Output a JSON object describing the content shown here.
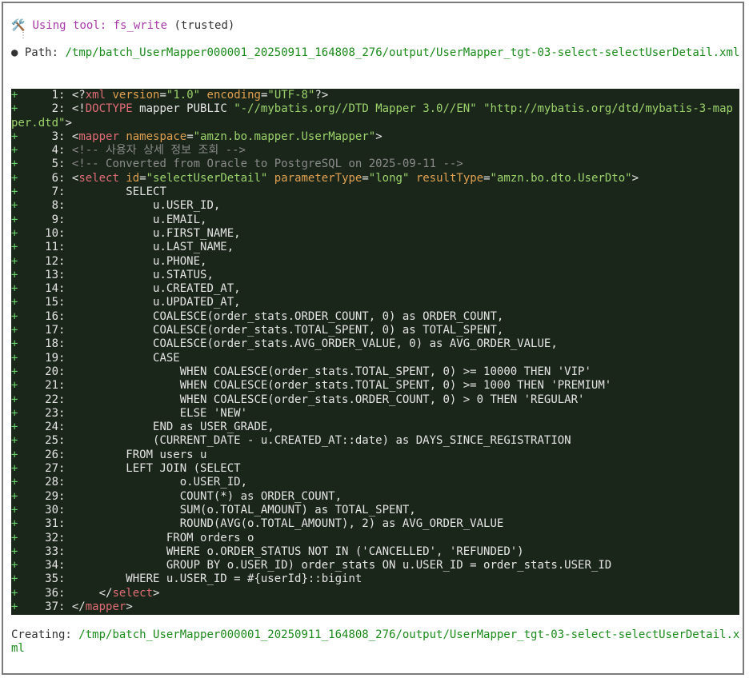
{
  "header": {
    "tool_icon": "🛠️",
    "label": "Using tool:",
    "tool_name": "fs_write",
    "trust": "(trusted)"
  },
  "path": {
    "bullet": "●",
    "label": "Path:",
    "value": "/tmp/batch_UserMapper000001_20250911_164808_276/output/UserMapper_tgt-03-select-selectUserDetail.xml"
  },
  "code_lines": [
    {
      "n": "1",
      "text": "<?xml version=\"1.0\" encoding=\"UTF-8\"?>"
    },
    {
      "n": "2",
      "text": "<!DOCTYPE mapper PUBLIC \"-//mybatis.org//DTD Mapper 3.0//EN\" \"http://mybatis.org/dtd/mybatis-3-mapper.dtd\">"
    },
    {
      "n": "3",
      "text": "<mapper namespace=\"amzn.bo.mapper.UserMapper\">"
    },
    {
      "n": "4",
      "text": "<!-- 사용자 상세 정보 조회 -->"
    },
    {
      "n": "5",
      "text": "<!-- Converted from Oracle to PostgreSQL on 2025-09-11 -->"
    },
    {
      "n": "6",
      "text": "<select id=\"selectUserDetail\" parameterType=\"long\" resultType=\"amzn.bo.dto.UserDto\">"
    },
    {
      "n": "7",
      "text": "        SELECT"
    },
    {
      "n": "8",
      "text": "            u.USER_ID,"
    },
    {
      "n": "9",
      "text": "            u.EMAIL,"
    },
    {
      "n": "10",
      "text": "            u.FIRST_NAME,"
    },
    {
      "n": "11",
      "text": "            u.LAST_NAME,"
    },
    {
      "n": "12",
      "text": "            u.PHONE,"
    },
    {
      "n": "13",
      "text": "            u.STATUS,"
    },
    {
      "n": "14",
      "text": "            u.CREATED_AT,"
    },
    {
      "n": "15",
      "text": "            u.UPDATED_AT,"
    },
    {
      "n": "16",
      "text": "            COALESCE(order_stats.ORDER_COUNT, 0) as ORDER_COUNT,"
    },
    {
      "n": "17",
      "text": "            COALESCE(order_stats.TOTAL_SPENT, 0) as TOTAL_SPENT,"
    },
    {
      "n": "18",
      "text": "            COALESCE(order_stats.AVG_ORDER_VALUE, 0) as AVG_ORDER_VALUE,"
    },
    {
      "n": "19",
      "text": "            CASE"
    },
    {
      "n": "20",
      "text": "                WHEN COALESCE(order_stats.TOTAL_SPENT, 0) >= 10000 THEN 'VIP'"
    },
    {
      "n": "21",
      "text": "                WHEN COALESCE(order_stats.TOTAL_SPENT, 0) >= 1000 THEN 'PREMIUM'"
    },
    {
      "n": "22",
      "text": "                WHEN COALESCE(order_stats.ORDER_COUNT, 0) > 0 THEN 'REGULAR'"
    },
    {
      "n": "23",
      "text": "                ELSE 'NEW'"
    },
    {
      "n": "24",
      "text": "            END as USER_GRADE,"
    },
    {
      "n": "25",
      "text": "            (CURRENT_DATE - u.CREATED_AT::date) as DAYS_SINCE_REGISTRATION"
    },
    {
      "n": "26",
      "text": "        FROM users u"
    },
    {
      "n": "27",
      "text": "        LEFT JOIN (SELECT"
    },
    {
      "n": "28",
      "text": "                o.USER_ID,"
    },
    {
      "n": "29",
      "text": "                COUNT(*) as ORDER_COUNT,"
    },
    {
      "n": "30",
      "text": "                SUM(o.TOTAL_AMOUNT) as TOTAL_SPENT,"
    },
    {
      "n": "31",
      "text": "                ROUND(AVG(o.TOTAL_AMOUNT), 2) as AVG_ORDER_VALUE"
    },
    {
      "n": "32",
      "text": "              FROM orders o"
    },
    {
      "n": "33",
      "text": "              WHERE o.ORDER_STATUS NOT IN ('CANCELLED', 'REFUNDED')"
    },
    {
      "n": "34",
      "text": "              GROUP BY o.USER_ID) order_stats ON u.USER_ID = order_stats.USER_ID"
    },
    {
      "n": "35",
      "text": "        WHERE u.USER_ID = #{userId}::bigint"
    },
    {
      "n": "36",
      "text": "    </select>"
    },
    {
      "n": "37",
      "text": "</mapper>"
    }
  ],
  "creating": {
    "label": "Creating:",
    "value": "/tmp/batch_UserMapper000001_20250911_164808_276/output/UserMapper_tgt-03-select-selectUserDetail.xml"
  },
  "colors": {
    "code_bg": "#1b261b",
    "tool_accent": "#a93aa9",
    "path_green": "#1a8a1a",
    "tag": "#e06c75",
    "attr": "#e0a050",
    "string": "#9bd36b",
    "comment": "#8a8a8a",
    "plus": "#6bd36b"
  }
}
